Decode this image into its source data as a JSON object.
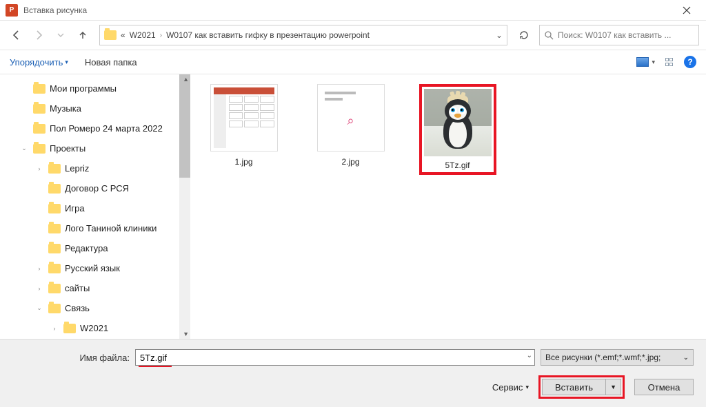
{
  "title": "Вставка рисунка",
  "breadcrumb": {
    "prefix": "«",
    "seg1": "W2021",
    "seg2": "W0107 как вставить гифку в презентацию powerpoint"
  },
  "search_placeholder": "Поиск: W0107 как вставить ...",
  "toolbar": {
    "organize": "Упорядочить",
    "new_folder": "Новая папка"
  },
  "tree": [
    {
      "label": "Мои программы",
      "indent": 28,
      "caret": ""
    },
    {
      "label": "Музыка",
      "indent": 28,
      "caret": ""
    },
    {
      "label": "Пол Ромеро 24 марта 2022",
      "indent": 28,
      "caret": ""
    },
    {
      "label": "Проекты",
      "indent": 28,
      "caret": "v"
    },
    {
      "label": "Lepriz",
      "indent": 50,
      "caret": ">"
    },
    {
      "label": "Договор С РСЯ",
      "indent": 50,
      "caret": ""
    },
    {
      "label": "Игра",
      "indent": 50,
      "caret": ""
    },
    {
      "label": "Лого Таниной клиники",
      "indent": 50,
      "caret": ""
    },
    {
      "label": "Редактура",
      "indent": 50,
      "caret": ""
    },
    {
      "label": "Русский язык",
      "indent": 50,
      "caret": ">"
    },
    {
      "label": "сайты",
      "indent": 50,
      "caret": ">"
    },
    {
      "label": "Связь",
      "indent": 50,
      "caret": "v"
    },
    {
      "label": "W2021",
      "indent": 72,
      "caret": ">"
    }
  ],
  "files": [
    {
      "name": "1.jpg",
      "kind": "ppt-thumb",
      "selected": false
    },
    {
      "name": "2.jpg",
      "kind": "slide-thumb",
      "selected": false
    },
    {
      "name": "5Tz.gif",
      "kind": "penguin",
      "selected": true
    }
  ],
  "footer": {
    "filename_label": "Имя файла:",
    "filename_value": "5Tz.gif",
    "filter": "Все рисунки (*.emf;*.wmf;*.jpg;",
    "tools": "Сервис",
    "insert": "Вставить",
    "cancel": "Отмена"
  }
}
